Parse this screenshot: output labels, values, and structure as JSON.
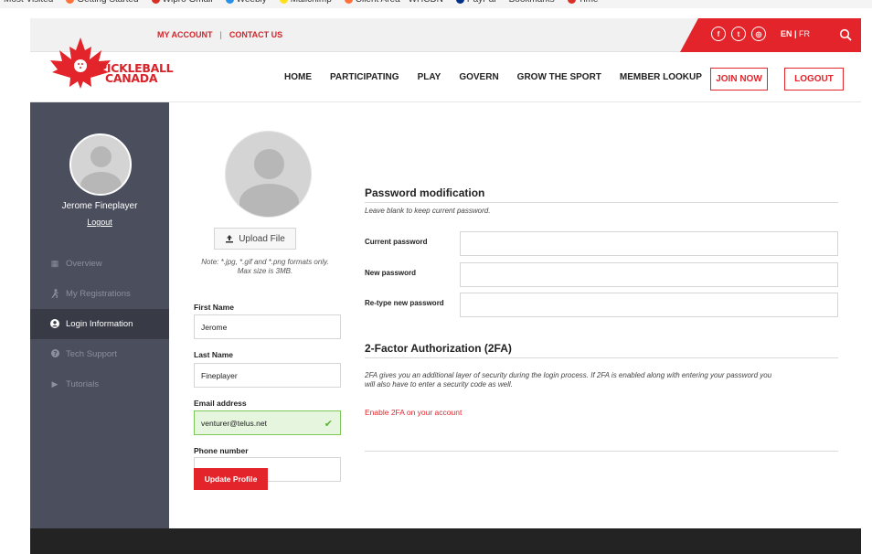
{
  "colors": {
    "brand_red": "#e3242b",
    "sidebar_bg": "#4b4e5c",
    "sidebar_active": "#383a45",
    "valid_green": "#e6f6de",
    "footer": "#232323"
  },
  "bookmarks": [
    {
      "label": "Most Visited",
      "icon": "none"
    },
    {
      "label": "Getting Started",
      "icon": "firefox-icon",
      "color": "#ff7139"
    },
    {
      "label": "Wipro Gmail",
      "icon": "gmail-icon",
      "color": "#d93025"
    },
    {
      "label": "Weebly",
      "icon": "weebly-icon",
      "color": "#2990ea"
    },
    {
      "label": "Mailchimp",
      "icon": "mailchimp-icon",
      "color": "#ffe01b"
    },
    {
      "label": "Client Area - WHCDN",
      "icon": "firefox-icon",
      "color": "#ff7139"
    },
    {
      "label": "PayPal",
      "icon": "paypal-icon",
      "color": "#003087"
    },
    {
      "label": "Bookmarks",
      "icon": "none"
    },
    {
      "label": "Time",
      "icon": "calendar-icon",
      "color": "#d93025"
    }
  ],
  "topbar": {
    "my_account": "MY ACCOUNT",
    "separator": "|",
    "contact_us": "CONTACT US",
    "social": [
      {
        "name": "facebook-icon",
        "glyph": "f"
      },
      {
        "name": "twitter-icon",
        "glyph": "t"
      },
      {
        "name": "instagram-icon",
        "glyph": "◎"
      }
    ],
    "lang_en": "EN",
    "lang_sep": " | ",
    "lang_fr": "FR"
  },
  "logo": {
    "line1": "PICKLEBALL",
    "line2": "CANADA"
  },
  "nav": {
    "items": [
      "HOME",
      "PARTICIPATING",
      "PLAY",
      "GOVERN",
      "GROW THE SPORT",
      "MEMBER LOOKUP"
    ],
    "join": "JOIN NOW",
    "logout": "LOGOUT"
  },
  "sidebar": {
    "user_name": "Jerome Fineplayer",
    "logout": "Logout",
    "items": [
      {
        "label": "Overview",
        "icon": "grid-icon",
        "glyph": "▦",
        "active": false
      },
      {
        "label": "My Registrations",
        "icon": "runner-icon",
        "glyph": "⯯",
        "active": false
      },
      {
        "label": "Login Information",
        "icon": "user-circle-icon",
        "glyph": "●",
        "active": true
      },
      {
        "label": "Tech Support",
        "icon": "question-icon",
        "glyph": "?",
        "active": false
      },
      {
        "label": "Tutorials",
        "icon": "play-icon",
        "glyph": "▶",
        "active": false
      }
    ]
  },
  "profile": {
    "upload_label": "Upload File",
    "note_line1": "Note: *.jpg, *.gif and *.png formats only.",
    "note_line2": "Max size is 3MB.",
    "first_name_label": "First Name",
    "first_name_value": "Jerome",
    "last_name_label": "Last Name",
    "last_name_value": "Fineplayer",
    "email_label": "Email address",
    "email_value": "venturer@telus.net",
    "phone_label": "Phone number",
    "phone_value": "",
    "update_button": "Update Profile"
  },
  "password": {
    "title": "Password modification",
    "subtitle": "Leave blank to keep current password.",
    "current_label": "Current password",
    "new_label": "New password",
    "retype_label": "Re-type new password"
  },
  "twofa": {
    "title": "2-Factor Authorization (2FA)",
    "description_line1": "2FA gives you an additional layer of security during the login process. If 2FA is enabled along with entering your password you",
    "description_line2": "will also have to enter a security code as well.",
    "enable_link": "Enable 2FA on your account"
  }
}
